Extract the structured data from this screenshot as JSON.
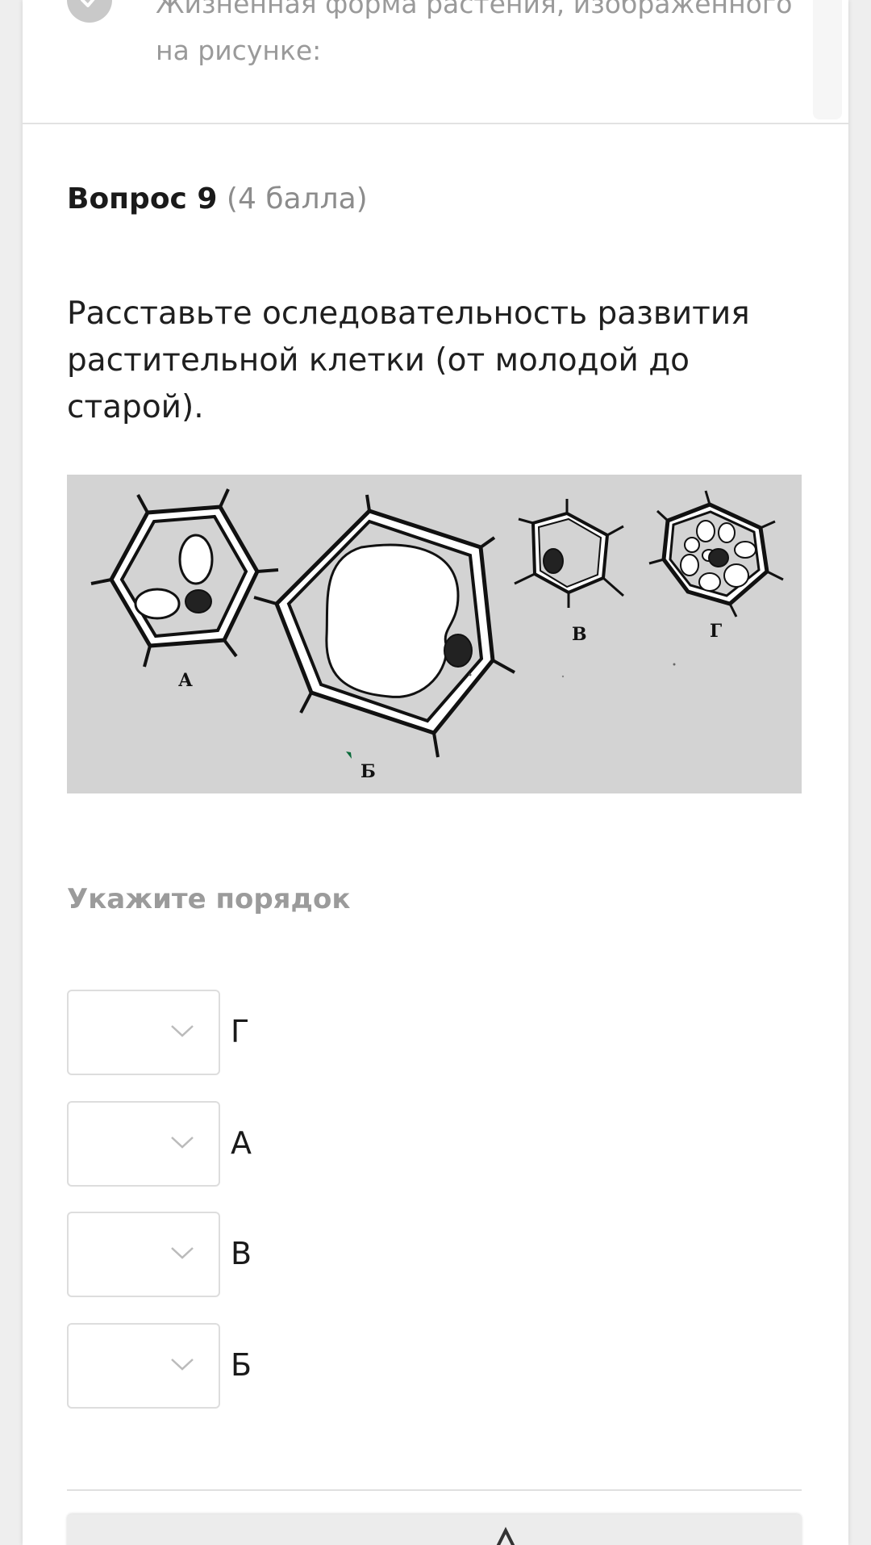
{
  "previous_question": {
    "text": "Жизненная форма растения, изображенного на рисунке:",
    "check_icon": "check-icon"
  },
  "question": {
    "title": "Вопрос 9",
    "points": "(4 балла)",
    "text": "Расставьте оследовательность развития растительной клетки (от молодой до старой)."
  },
  "figure": {
    "labels": [
      "А",
      "Б",
      "В",
      "Г"
    ]
  },
  "instruction": "Укажите порядок",
  "order_items": [
    {
      "select_value": "",
      "label": "Г"
    },
    {
      "select_value": "",
      "label": "А"
    },
    {
      "select_value": "",
      "label": "В"
    },
    {
      "select_value": "",
      "label": "Б"
    }
  ],
  "colors": {
    "card_background": "#ffffff",
    "page_background": "#eeeeee",
    "figure_background": "#d3d3d3",
    "muted_text": "#9b9b9b"
  }
}
